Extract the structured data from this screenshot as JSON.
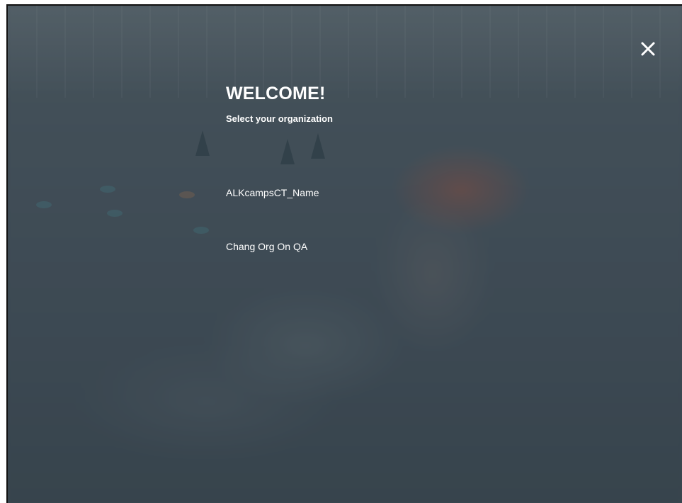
{
  "header": {
    "title": "WELCOME!",
    "subtitle": "Select your organization"
  },
  "close": {
    "icon": "close-icon"
  },
  "organizations": [
    {
      "label": "ALKcampsCT_Name"
    },
    {
      "label": "Chang Org On QA"
    }
  ]
}
